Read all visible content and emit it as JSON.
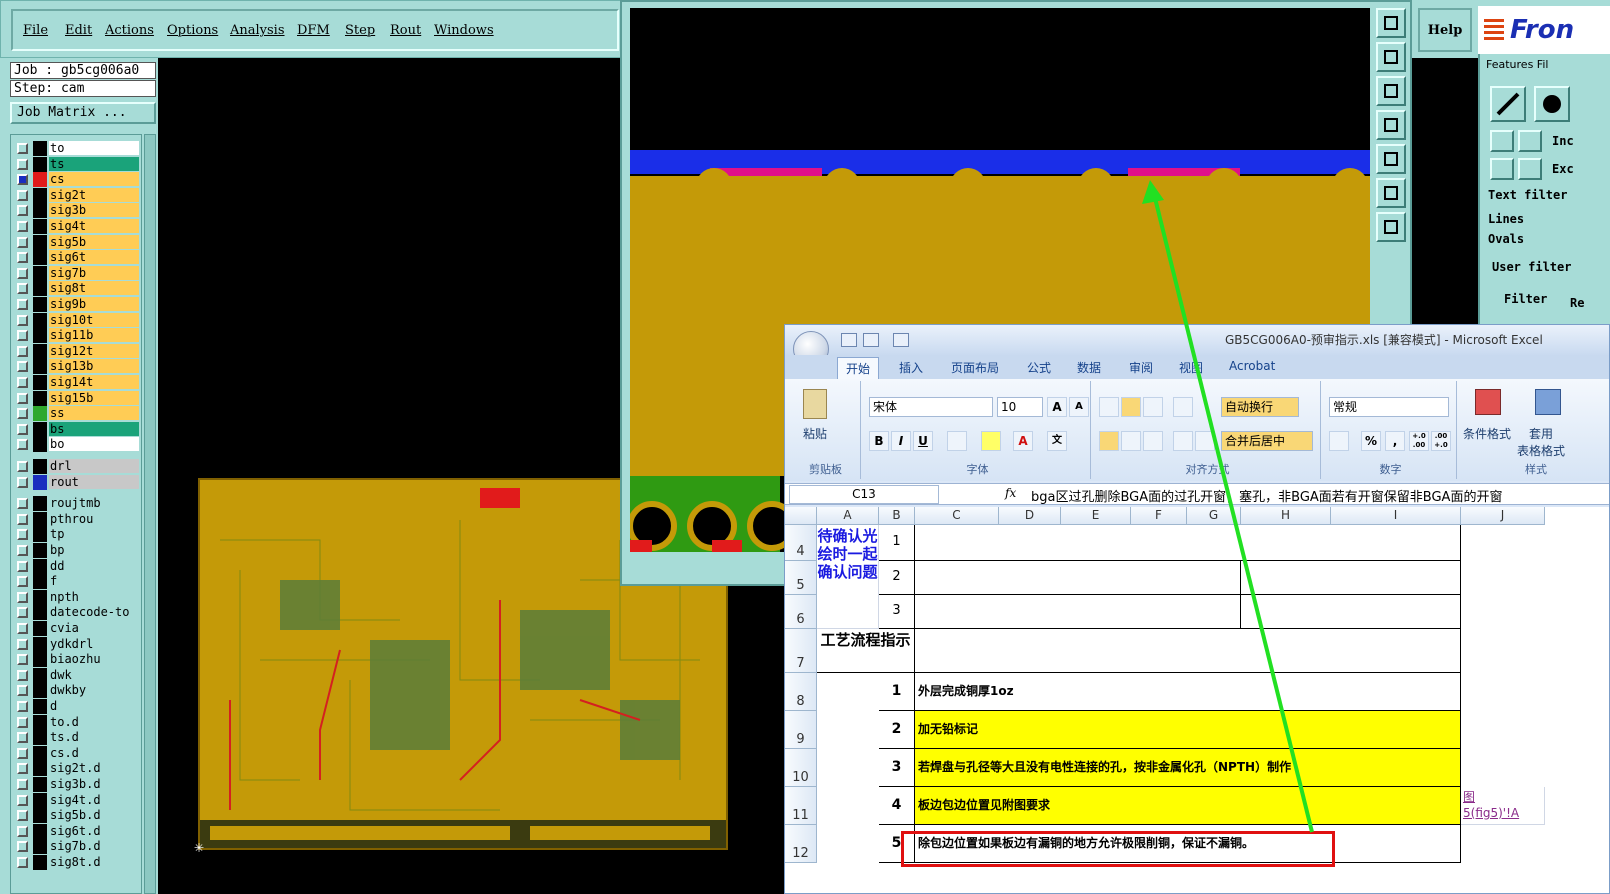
{
  "menubar": {
    "items": [
      "File",
      "Edit",
      "Actions",
      "Options",
      "Analysis",
      "DFM",
      "Step",
      "Rout",
      "Windows"
    ],
    "help": "Help",
    "logo": "Fron"
  },
  "job": {
    "job_line": "Job : gb5cg006a0",
    "step_line": "Step: cam",
    "matrix_button": "Job Matrix ..."
  },
  "layers": [
    {
      "name": "to",
      "bg": "#ffffff",
      "swatch": "#000000",
      "checked": false
    },
    {
      "name": "ts",
      "bg": "#1aa37a",
      "swatch": "#000000",
      "checked": false
    },
    {
      "name": "cs",
      "bg": "#ffcc55",
      "swatch": "#e11b1b",
      "checked": true
    },
    {
      "name": "sig2t",
      "bg": "#ffcc55",
      "swatch": "#000000",
      "checked": false
    },
    {
      "name": "sig3b",
      "bg": "#ffcc55",
      "swatch": "#000000",
      "checked": false
    },
    {
      "name": "sig4t",
      "bg": "#ffcc55",
      "swatch": "#000000",
      "checked": false
    },
    {
      "name": "sig5b",
      "bg": "#ffcc55",
      "swatch": "#000000",
      "checked": false
    },
    {
      "name": "sig6t",
      "bg": "#ffcc55",
      "swatch": "#000000",
      "checked": false
    },
    {
      "name": "sig7b",
      "bg": "#ffcc55",
      "swatch": "#000000",
      "checked": false
    },
    {
      "name": "sig8t",
      "bg": "#ffcc55",
      "swatch": "#000000",
      "checked": false
    },
    {
      "name": "sig9b",
      "bg": "#ffcc55",
      "swatch": "#000000",
      "checked": false
    },
    {
      "name": "sig10t",
      "bg": "#ffcc55",
      "swatch": "#000000",
      "checked": false
    },
    {
      "name": "sig11b",
      "bg": "#ffcc55",
      "swatch": "#000000",
      "checked": false
    },
    {
      "name": "sig12t",
      "bg": "#ffcc55",
      "swatch": "#000000",
      "checked": false
    },
    {
      "name": "sig13b",
      "bg": "#ffcc55",
      "swatch": "#000000",
      "checked": false
    },
    {
      "name": "sig14t",
      "bg": "#ffcc55",
      "swatch": "#000000",
      "checked": false
    },
    {
      "name": "sig15b",
      "bg": "#ffcc55",
      "swatch": "#000000",
      "checked": false
    },
    {
      "name": "ss",
      "bg": "#ffcc55",
      "swatch": "#2ea82e",
      "checked": false
    },
    {
      "name": "bs",
      "bg": "#1aa37a",
      "swatch": "#000000",
      "checked": false
    },
    {
      "name": "bo",
      "bg": "#ffffff",
      "swatch": "#000000",
      "checked": false
    },
    {
      "name": "drl",
      "bg": "#c8c8c8",
      "swatch": "#000000",
      "checked": false
    },
    {
      "name": "rout",
      "bg": "#c8c8c8",
      "swatch": "#1a2fbf",
      "checked": false
    },
    {
      "name": "roujtmb",
      "bg": "#a7dcd7",
      "swatch": "#000000",
      "checked": false
    },
    {
      "name": "pthrou",
      "bg": "#a7dcd7",
      "swatch": "#000000",
      "checked": false
    },
    {
      "name": "tp",
      "bg": "#a7dcd7",
      "swatch": "#000000",
      "checked": false
    },
    {
      "name": "bp",
      "bg": "#a7dcd7",
      "swatch": "#000000",
      "checked": false
    },
    {
      "name": "dd",
      "bg": "#a7dcd7",
      "swatch": "#000000",
      "checked": false
    },
    {
      "name": "f",
      "bg": "#a7dcd7",
      "swatch": "#000000",
      "checked": false
    },
    {
      "name": "npth",
      "bg": "#a7dcd7",
      "swatch": "#000000",
      "checked": false
    },
    {
      "name": "datecode-to",
      "bg": "#a7dcd7",
      "swatch": "#000000",
      "checked": false
    },
    {
      "name": "cvia",
      "bg": "#a7dcd7",
      "swatch": "#000000",
      "checked": false
    },
    {
      "name": "ydkdrl",
      "bg": "#a7dcd7",
      "swatch": "#000000",
      "checked": false
    },
    {
      "name": "biaozhu",
      "bg": "#a7dcd7",
      "swatch": "#000000",
      "checked": false
    },
    {
      "name": "dwk",
      "bg": "#a7dcd7",
      "swatch": "#000000",
      "checked": false
    },
    {
      "name": "dwkby",
      "bg": "#a7dcd7",
      "swatch": "#000000",
      "checked": false
    },
    {
      "name": "d",
      "bg": "#a7dcd7",
      "swatch": "#000000",
      "checked": false
    },
    {
      "name": "to.d",
      "bg": "#a7dcd7",
      "swatch": "#000000",
      "checked": false
    },
    {
      "name": "ts.d",
      "bg": "#a7dcd7",
      "swatch": "#000000",
      "checked": false
    },
    {
      "name": "cs.d",
      "bg": "#a7dcd7",
      "swatch": "#000000",
      "checked": false
    },
    {
      "name": "sig2t.d",
      "bg": "#a7dcd7",
      "swatch": "#000000",
      "checked": false
    },
    {
      "name": "sig3b.d",
      "bg": "#a7dcd7",
      "swatch": "#000000",
      "checked": false
    },
    {
      "name": "sig4t.d",
      "bg": "#a7dcd7",
      "swatch": "#000000",
      "checked": false
    },
    {
      "name": "sig5b.d",
      "bg": "#a7dcd7",
      "swatch": "#000000",
      "checked": false
    },
    {
      "name": "sig6t.d",
      "bg": "#a7dcd7",
      "swatch": "#000000",
      "checked": false
    },
    {
      "name": "sig7b.d",
      "bg": "#a7dcd7",
      "swatch": "#000000",
      "checked": false
    },
    {
      "name": "sig8t.d",
      "bg": "#a7dcd7",
      "swatch": "#000000",
      "checked": false
    }
  ],
  "features_panel": {
    "title": "Features Fil",
    "include": "Inc",
    "exclude": "Exc",
    "text_filter": "Text filter",
    "lines": "Lines",
    "ovals": "Ovals",
    "user_filter": "User filter",
    "filter": "Filter",
    "reset": "Re"
  },
  "excel": {
    "title": "GB5CG006A0-预审指示.xls  [兼容模式] - Microsoft Excel",
    "tabs": [
      "开始",
      "插入",
      "页面布局",
      "公式",
      "数据",
      "审阅",
      "视图",
      "Acrobat"
    ],
    "clipboard": {
      "paste": "粘贴",
      "group": "剪贴板"
    },
    "font": {
      "name": "宋体",
      "size": "10",
      "group": "字体",
      "bold": "B",
      "italic": "I",
      "underline": "U",
      "grow": "A",
      "shrink": "A",
      "color": "A",
      "phonetic": "文"
    },
    "alignment": {
      "wrap": "自动换行",
      "merge": "合并后居中",
      "group": "对齐方式"
    },
    "number": {
      "format": "常规",
      "percent": "%",
      "comma": ",",
      "group": "数字",
      "inc_decimal": "+.0 .00",
      "dec_decimal": ".00 +.0"
    },
    "styles": {
      "conditional": "条件格式",
      "table": "套用\n表格格式",
      "group": "样式"
    },
    "name_box": "C13",
    "fx": "fx",
    "formula": "bga区过孔删除BGA面的过孔开窗，塞孔，非BGA面若有开窗保留非BGA面的开窗",
    "columns": [
      "A",
      "B",
      "C",
      "D",
      "E",
      "F",
      "G",
      "H",
      "I",
      "J"
    ],
    "rows": [
      "4",
      "5",
      "6",
      "7",
      "8",
      "9",
      "10",
      "11",
      "12"
    ],
    "confirm_label": "待确认光绘时一起确认问题",
    "process_label": "工艺流程指示",
    "confirm_numbers": [
      "1",
      "2",
      "3"
    ],
    "steps": [
      {
        "n": "1",
        "text": "外层完成铜厚1oz",
        "highlight": false
      },
      {
        "n": "2",
        "text": "加无铅标记",
        "highlight": true
      },
      {
        "n": "3",
        "text": "若焊盘与孔径等大且没有电性连接的孔，按非金属化孔（NPTH）制作",
        "highlight": true
      },
      {
        "n": "4",
        "text": "板边包边位置见附图要求",
        "highlight": true
      },
      {
        "n": "5",
        "text": "除包边位置如果板边有漏铜的地方允许极限削铜，保证不漏铜。",
        "highlight": false
      }
    ],
    "link_text": [
      "图",
      "5(fig5)'!A"
    ]
  },
  "colors": {
    "genesis_bg": "#a7dcd7",
    "board_copper": "#c49a08",
    "annotation_arrow": "#22e022",
    "annotation_box": "#e01010",
    "excel_highlight": "#ffff00"
  }
}
